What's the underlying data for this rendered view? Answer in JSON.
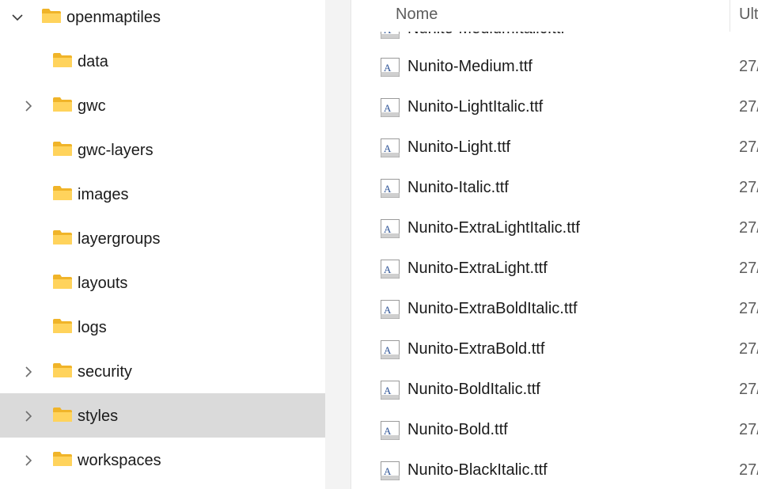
{
  "navigation": {
    "items": [
      {
        "label": "openmaptiles",
        "chevron": "chevron-down",
        "level": 0,
        "selected": false
      },
      {
        "label": "data",
        "chevron": "",
        "level": 1,
        "selected": false
      },
      {
        "label": "gwc",
        "chevron": "chevron-right",
        "level": 1,
        "selected": false
      },
      {
        "label": "gwc-layers",
        "chevron": "",
        "level": 1,
        "selected": false
      },
      {
        "label": "images",
        "chevron": "",
        "level": 1,
        "selected": false
      },
      {
        "label": "layergroups",
        "chevron": "",
        "level": 1,
        "selected": false
      },
      {
        "label": "layouts",
        "chevron": "",
        "level": 1,
        "selected": false
      },
      {
        "label": "logs",
        "chevron": "",
        "level": 1,
        "selected": false
      },
      {
        "label": "security",
        "chevron": "chevron-right",
        "level": 1,
        "selected": false
      },
      {
        "label": "styles",
        "chevron": "chevron-right",
        "level": 1,
        "selected": true
      },
      {
        "label": "workspaces",
        "chevron": "chevron-right",
        "level": 1,
        "selected": false
      }
    ]
  },
  "file_list": {
    "columns": {
      "name": "Nome",
      "date": "Ult"
    },
    "partial_top_file": "Nunito-MediumItalic.ttf",
    "files": [
      {
        "name": "Nunito-Medium.ttf",
        "date": "27/"
      },
      {
        "name": "Nunito-LightItalic.ttf",
        "date": "27/"
      },
      {
        "name": "Nunito-Light.ttf",
        "date": "27/"
      },
      {
        "name": "Nunito-Italic.ttf",
        "date": "27/"
      },
      {
        "name": "Nunito-ExtraLightItalic.ttf",
        "date": "27/"
      },
      {
        "name": "Nunito-ExtraLight.ttf",
        "date": "27/"
      },
      {
        "name": "Nunito-ExtraBoldItalic.ttf",
        "date": "27/"
      },
      {
        "name": "Nunito-ExtraBold.ttf",
        "date": "27/"
      },
      {
        "name": "Nunito-BoldItalic.ttf",
        "date": "27/"
      },
      {
        "name": "Nunito-Bold.ttf",
        "date": "27/"
      },
      {
        "name": "Nunito-BlackItalic.ttf",
        "date": "27/"
      }
    ]
  },
  "icons": {
    "folder": "folder-icon",
    "font_file": "font-file-icon",
    "expanded": "chevron-down-icon",
    "collapsed": "chevron-right-icon"
  },
  "colors": {
    "folder_yellow": "#ffc83d",
    "folder_dark": "#e8a317",
    "selected_bg": "#dadada",
    "header_text": "#5d5d5d",
    "font_icon_blue": "#2f5597"
  }
}
